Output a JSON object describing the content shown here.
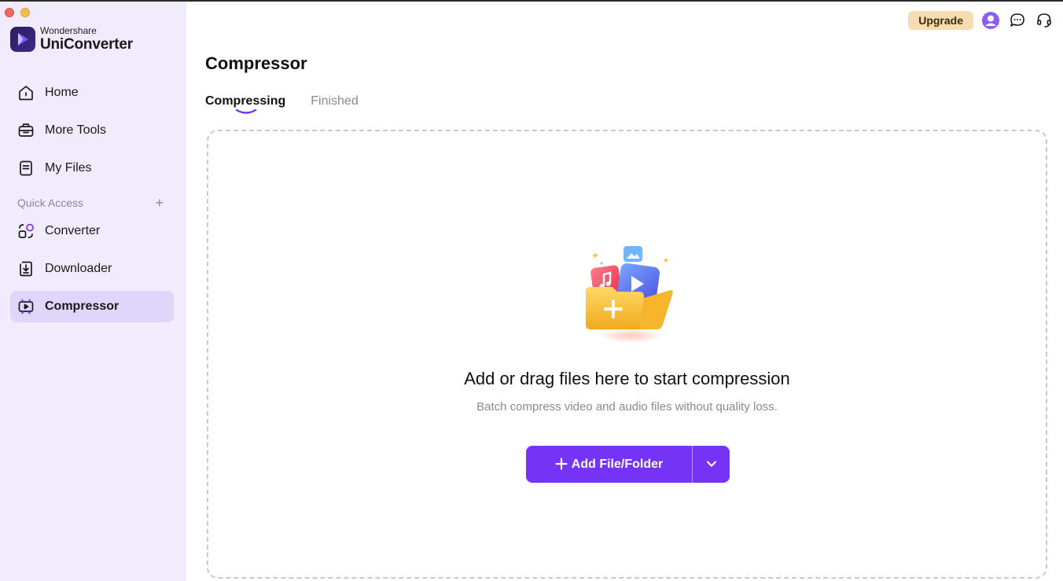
{
  "sidebar": {
    "brand": {
      "sub": "Wondershare",
      "name": "UniConverter"
    },
    "nav": [
      {
        "label": "Home",
        "icon": "home-icon"
      },
      {
        "label": "More Tools",
        "icon": "toolbox-icon"
      },
      {
        "label": "My Files",
        "icon": "file-icon"
      }
    ],
    "quick_access": {
      "label": "Quick Access",
      "add_label": "+",
      "items": [
        {
          "label": "Converter",
          "icon": "converter-icon"
        },
        {
          "label": "Downloader",
          "icon": "downloader-icon"
        },
        {
          "label": "Compressor",
          "icon": "compressor-icon",
          "active": true
        }
      ]
    }
  },
  "topbar": {
    "upgrade_label": "Upgrade",
    "icons": [
      "avatar-icon",
      "chat-icon",
      "headset-icon"
    ]
  },
  "main": {
    "title": "Compressor",
    "tabs": [
      {
        "label": "Compressing",
        "active": true
      },
      {
        "label": "Finished",
        "active": false
      }
    ],
    "dropzone": {
      "title": "Add or drag files here to start compression",
      "subtitle": "Batch compress video and audio files without quality loss.",
      "add_button_label": "Add File/Folder",
      "add_button_icon": "plus-icon",
      "dropdown_icon": "chevron-down-icon"
    }
  },
  "colors": {
    "accent": "#7533f5",
    "sidebar_bg": "#f1ecfd",
    "active_item_bg": "#e0d6fb",
    "upgrade_bg": "#f6dcb0"
  }
}
